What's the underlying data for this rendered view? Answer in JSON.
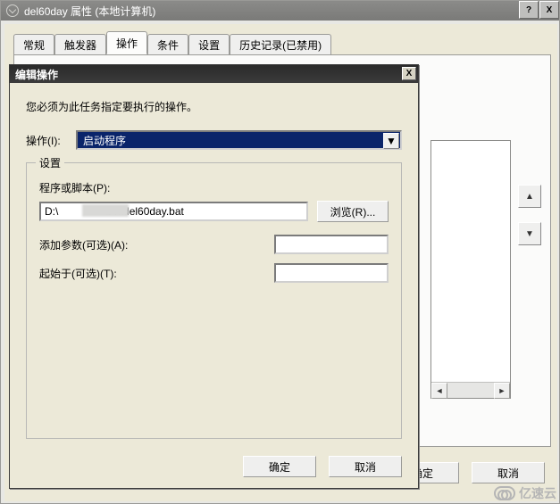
{
  "outer": {
    "title": "del60day 属性 (本地计算机)",
    "close_x": "X",
    "help_q": "?",
    "tabs": {
      "general": "常规",
      "triggers": "触发器",
      "actions": "操作",
      "conditions": "条件",
      "settings": "设置",
      "history": "历史记录(已禁用)"
    },
    "ok": "确定",
    "cancel": "取消"
  },
  "dialog": {
    "title": "编辑操作",
    "close_x": "X",
    "prompt": "您必须为此任务指定要执行的操作。",
    "op_label": "操作(I):",
    "op_value": "启动程序",
    "group_label": "设置",
    "script_label": "程序或脚本(P):",
    "script_value": "D:\\                bin\\del60day.bat",
    "browse_label": "浏览(R)...",
    "args_label": "添加参数(可选)(A):",
    "args_value": "",
    "startin_label": "起始于(可选)(T):",
    "startin_value": "",
    "ok": "确定",
    "cancel": "取消"
  },
  "watermark": "亿速云"
}
